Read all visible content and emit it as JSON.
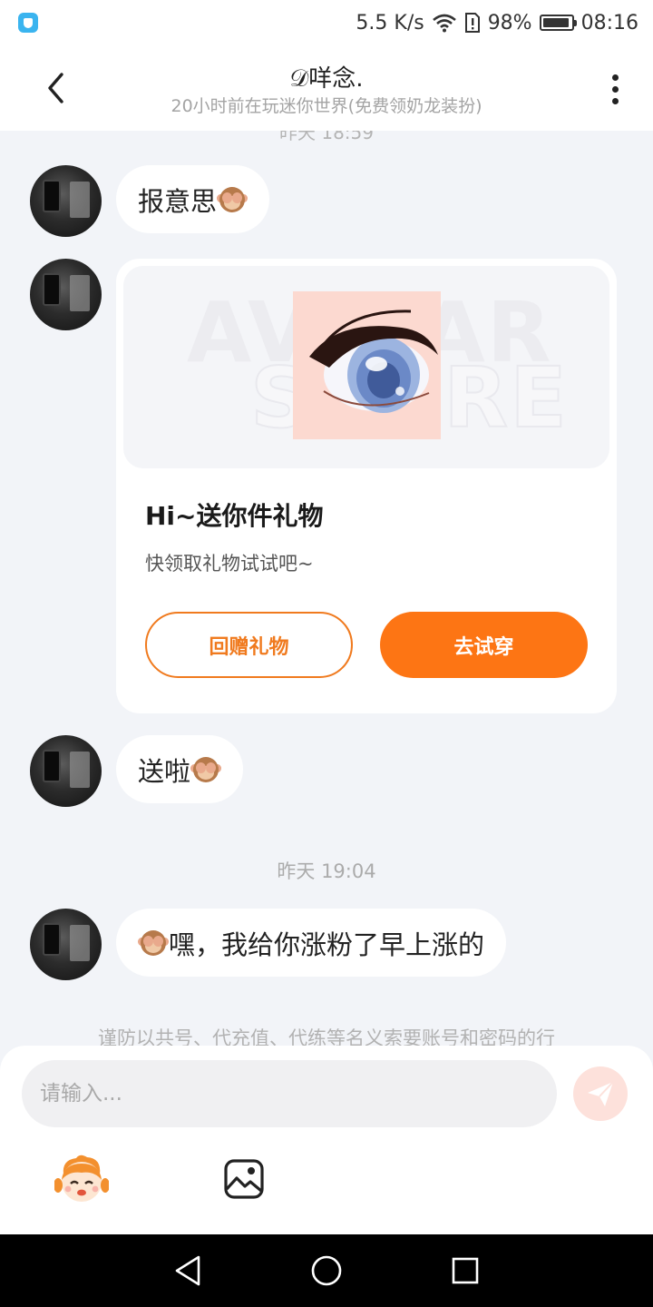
{
  "status_bar": {
    "net_speed": "5.5 K/s",
    "battery": "98%",
    "time": "08:16"
  },
  "header": {
    "title": "𝒟咩念.",
    "subtitle": "20小时前在玩迷你世界(免费领奶龙装扮)"
  },
  "messages": [
    {
      "text": "报意思"
    },
    {
      "type": "gift_card",
      "watermark": [
        "AVATAR",
        "STORE"
      ],
      "title": "Hi~送你件礼物",
      "desc": "快领取礼物试试吧~",
      "return_label": "回赠礼物",
      "try_label": "去试穿"
    },
    {
      "text": "送啦"
    },
    {
      "text": "嘿，我给你涨粉了早上涨的"
    }
  ],
  "cut_timestamp": "昨天 18:59",
  "timestamp": "昨天 19:04",
  "notice": "谨防以共号、代充值、代练等名义索要账号和密码的行",
  "input": {
    "placeholder": "请输入..."
  },
  "colors": {
    "accent": "#fd7514",
    "background": "#f2f4f8",
    "send_button_bg": "#fde1db"
  },
  "icons": [
    "back-arrow-icon",
    "more-vertical-icon",
    "monkey-emoji-icon",
    "send-icon",
    "emoji-avatar-icon",
    "image-icon",
    "nav-back-icon",
    "nav-home-icon",
    "nav-recents-icon"
  ]
}
